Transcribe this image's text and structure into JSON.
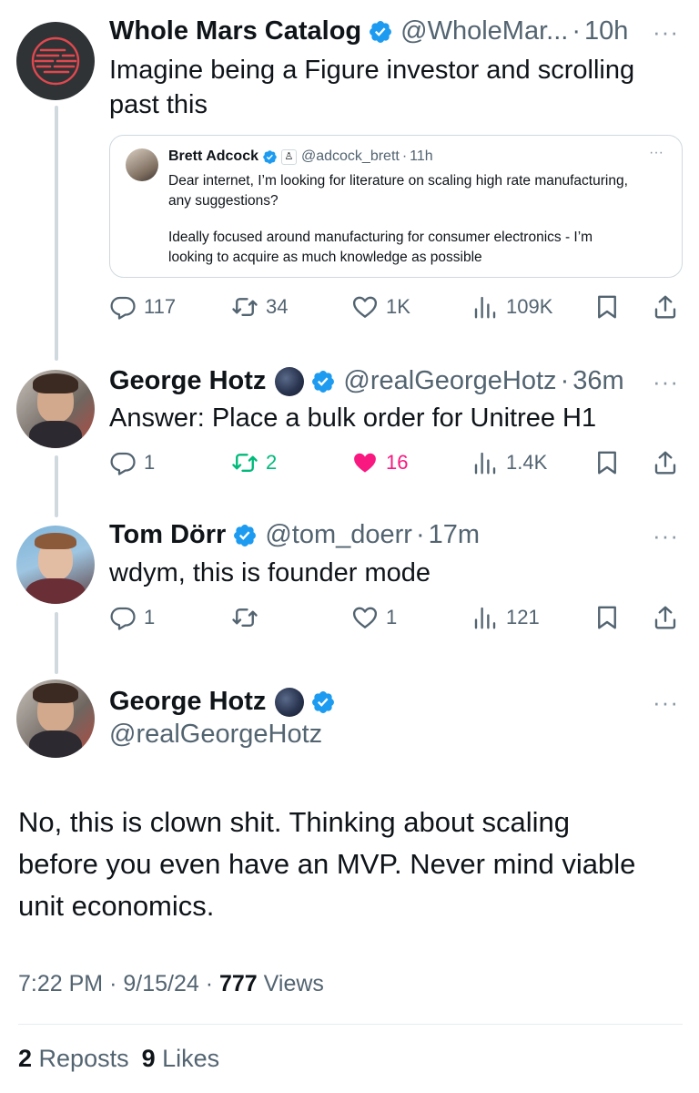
{
  "tweets": [
    {
      "name": "Whole Mars Catalog",
      "handle": "@WholeMar...",
      "time": "10h",
      "text_line1": "Imagine being a Figure investor and scrolling",
      "text_line2": "past this",
      "quote": {
        "name": "Brett Adcock",
        "handle": "@adcock_brett",
        "time": "11h",
        "line1": "Dear internet, I’m looking for literature on scaling high rate manufacturing,",
        "line2": "any suggestions?",
        "line3": "Ideally focused around manufacturing for consumer electronics - I’m",
        "line4": "looking to acquire as much knowledge as possible"
      },
      "actions": {
        "replies": "117",
        "reposts": "34",
        "likes": "1K",
        "views": "109K"
      }
    },
    {
      "name": "George Hotz",
      "handle": "@realGeorgeHotz",
      "time": "36m",
      "text": "Answer: Place a bulk order for Unitree H1",
      "actions": {
        "replies": "1",
        "reposts": "2",
        "likes": "16",
        "views": "1.4K"
      }
    },
    {
      "name": "Tom Dörr",
      "handle": "@tom_doerr",
      "time": "17m",
      "text": "wdym, this is founder mode",
      "actions": {
        "replies": "1",
        "reposts": "",
        "likes": "1",
        "views": "121"
      }
    }
  ],
  "main": {
    "name": "George Hotz",
    "handle": "@realGeorgeHotz",
    "text_line1": "No, this is clown shit. Thinking about scaling",
    "text_line2": "before you even have an MVP. Never mind viable",
    "text_line3": "unit economics.",
    "time": "7:22 PM",
    "date": "9/15/24",
    "views_count": "777",
    "views_label": "Views",
    "reposts_count": "2",
    "reposts_label": "Reposts",
    "likes_count": "9",
    "likes_label": "Likes"
  },
  "ui": {
    "separator": "·",
    "more": "···"
  },
  "colors": {
    "verified": "#1d9bf0",
    "text_primary": "#0f1419",
    "text_secondary": "#536471",
    "repost_active": "#00ba7c",
    "like_active": "#f91880",
    "thread_line": "#cfd9de"
  },
  "icons": [
    "reply-icon",
    "repost-icon",
    "like-icon",
    "views-icon",
    "bookmark-icon",
    "share-icon",
    "verified-badge-icon",
    "moon-icon",
    "more-icon"
  ]
}
